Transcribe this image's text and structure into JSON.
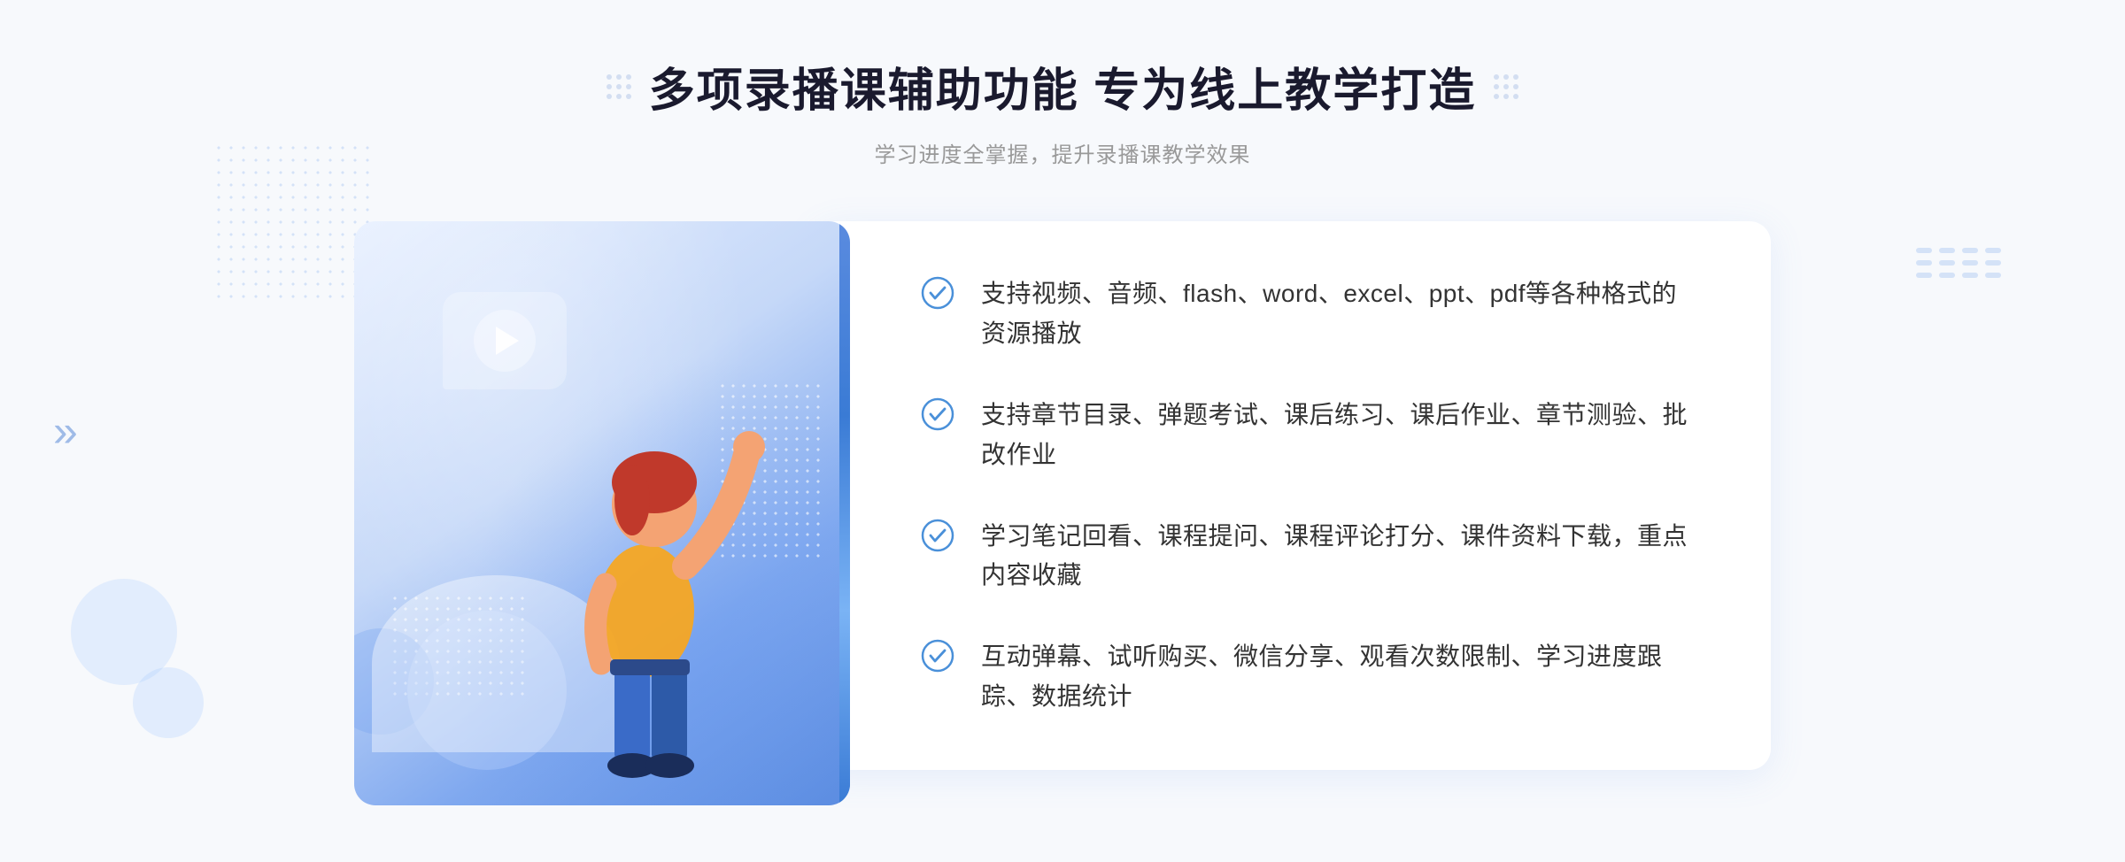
{
  "header": {
    "title": "多项录播课辅助功能 专为线上教学打造",
    "subtitle": "学习进度全掌握，提升录播课教学效果",
    "title_dots_label": "decorative dots"
  },
  "features": [
    {
      "id": 1,
      "text": "支持视频、音频、flash、word、excel、ppt、pdf等各种格式的资源播放"
    },
    {
      "id": 2,
      "text": "支持章节目录、弹题考试、课后练习、课后作业、章节测验、批改作业"
    },
    {
      "id": 3,
      "text": "学习笔记回看、课程提问、课程评论打分、课件资料下载，重点内容收藏"
    },
    {
      "id": 4,
      "text": "互动弹幕、试听购买、微信分享、观看次数限制、学习进度跟踪、数据统计"
    }
  ],
  "colors": {
    "primary": "#3a7bd5",
    "light_blue": "#7ab3f5",
    "bg_gradient_start": "#e8f0ff",
    "bg_gradient_end": "#5a8bdf",
    "text_dark": "#1a1a2e",
    "text_gray": "#999999",
    "text_feature": "#333333",
    "check_color": "#4a90d9",
    "card_bg": "#ffffff"
  },
  "illustration": {
    "play_button_label": "play button",
    "arrow_label": "navigation arrow"
  }
}
